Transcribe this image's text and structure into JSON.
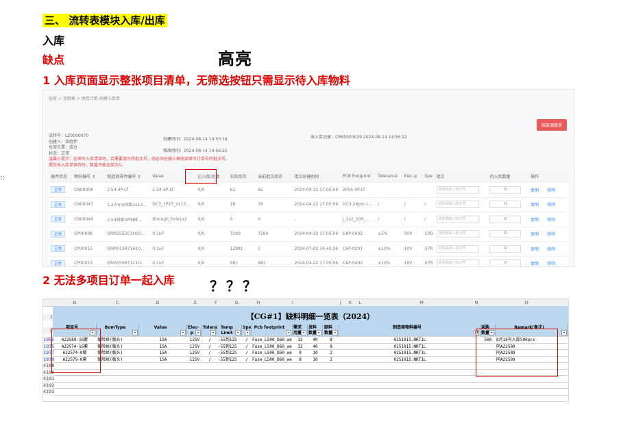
{
  "doc": {
    "heading": "三、 流转表模块入库/出库",
    "section": "入库",
    "weakness": "缺点",
    "highlight": "高亮",
    "issue1": "1 入库页面显示整张项目清单，无筛选按钮只需显示待入库物料",
    "issue2": "2 无法多项目订单一起入库",
    "question_marks": "？？？",
    "side_glyph": "::"
  },
  "shot1": {
    "breadcrumb": "仓库 > 流转表 > 项目订单-创建入库单",
    "confirm_button": "结束调拨单",
    "meta_left": [
      "流转号：LZ0000070",
      "创建人：张晓伊",
      "仓库位置：成仓",
      "状态：正常"
    ],
    "meta_note": [
      "温馨小提示：在填写入库清单时，若需要填写的批次号，则必须在输入框底部填写订单号的批次号。",
      "提交出入库单保存时，数量不能全部为0。"
    ],
    "meta_mid": [
      "创建时间：2024-08-14 14:50:18",
      "修改时间：2024-08-14 14:56:22"
    ],
    "meta_right": "出入库记录：CRK0000029 2024-08-14 14:56:22",
    "columns": [
      "器件状态",
      "物料编号 ⇕",
      "制造商零件编号 ⇕",
      "Value",
      "已入库/总数",
      "实际库存",
      "当前批次库存",
      "批次创建时间",
      "PCB Footprint",
      "Tolerance",
      "Elec-p",
      "Spe",
      "批次",
      "待入库数量",
      "操作"
    ],
    "rows": [
      {
        "status": "正常",
        "code": "CN00006",
        "mpn": "2.54-4P-LT",
        "value": "2.54-4P-LT",
        "ratio": "0/0",
        "stock": "61",
        "batch": "61",
        "time": "2024-04-22 17:05:06",
        "fp": "2P54-4P-LT",
        "tol": "",
        "elec": "",
        "spe": "",
        "sel": "选择或输入批次号",
        "qty": "0",
        "op1": "复制",
        "op2": "移除"
      },
      {
        "status": "正常",
        "code": "CN00047",
        "mpn": "1.27mm间距2x13...",
        "value": "DC3_1P27_2x13...",
        "ratio": "0/0",
        "stock": "18",
        "batch": "18",
        "time": "2024-04-22 17:05:06",
        "fp": "DC3-26pin-1...",
        "tol": "/",
        "elec": "/",
        "spe": "/",
        "sel": "选择或输入批次号",
        "qty": "0",
        "op1": "复制",
        "op2": "移除"
      },
      {
        "status": "正常",
        "code": "CN00049",
        "mpn": "2.54间距4PIN排...",
        "value": "through_hole1x2",
        "ratio": "0/0",
        "stock": "0",
        "batch": "0",
        "time": "-",
        "fp": "J_1x2_100_...",
        "tol": "/",
        "elec": "/",
        "spe": "/",
        "sel": "选择或输入批次号",
        "qty": "0",
        "op1": "复制",
        "op2": "移除"
      },
      {
        "status": "正常",
        "code": "CP00006",
        "mpn": "GRM1555C1H10...",
        "value": "0.1nF",
        "ratio": "0/0",
        "stock": "7260",
        "batch": "7260",
        "time": "2024-04-22 17:05:06",
        "fp": "CAP-0402",
        "tol": "±5%",
        "elec": "50V",
        "spe": "C0G",
        "sel": "选择或输入批次号",
        "qty": "0",
        "op1": "复制",
        "op2": "移除"
      },
      {
        "status": "正常",
        "code": "CP00015",
        "mpn": "GRM033R71A10...",
        "value": "0.1uF",
        "ratio": "0/0",
        "stock": "12981",
        "batch": "1",
        "time": "2024-07-02 16:40:36",
        "fp": "CAP-0201",
        "tol": "±10%",
        "elec": "10V",
        "spe": "X7R",
        "sel": "选择或输入批次号",
        "qty": "0",
        "op1": "复制",
        "op2": "移除"
      },
      {
        "status": "正常",
        "code": "CP00023",
        "mpn": "GRM155R71C10...",
        "value": "0.1uF",
        "ratio": "0/0",
        "stock": "981",
        "batch": "981",
        "time": "2024-04-22 17:05:06",
        "fp": "CAP-0402",
        "tol": "±10%",
        "elec": "16V",
        "spe": "X7R",
        "sel": "选择或输入批次号",
        "qty": "0",
        "op1": "复制",
        "op2": "移除"
      }
    ]
  },
  "shot2": {
    "col_letters": [
      "B",
      "C",
      "D",
      "E",
      "F",
      "G",
      "H",
      "I",
      "J",
      "K",
      "L",
      "M",
      "N",
      "O"
    ],
    "title": "【CG#1】缺料明细一览表（2024）",
    "headers": [
      "项目号",
      "BomType",
      "Value",
      "Elec-p",
      "Tolerance",
      "Temp Limit",
      "Spe",
      "Pcb footprint",
      "需求用量",
      "发料数量",
      "缺料数量",
      "制造商物料编号",
      "采购数量",
      "Remark(备注)"
    ],
    "row_numbers": [
      "1",
      "2",
      "1955",
      "1975",
      "1977",
      "1979",
      "4188",
      "4190",
      "4191",
      "4192",
      "4193"
    ],
    "rows": [
      {
        "proj": "A22589-16套",
        "bom": "保险丝(板头)",
        "val": "15A",
        "elec": "125V",
        "tol": "/",
        "temp": "-55到125",
        "spe": "/",
        "fp": "Fuse_L500_D60_weld",
        "need": "32",
        "issue": "40",
        "short": "8",
        "mpn": "0251015.NRT1L",
        "buy": "500",
        "remark": "8月16号入库500pcs"
      },
      {
        "proj": "A22574-16套",
        "bom": "保险丝(板头)",
        "val": "15A",
        "elec": "125V",
        "tol": "/",
        "temp": "-55到125",
        "spe": "/",
        "fp": "Fuse_L500_D60_weld",
        "need": "32",
        "issue": "40",
        "short": "8",
        "mpn": "0251015.NRT1L",
        "buy": "",
        "remark": "同A22589"
      },
      {
        "proj": "A22574-8套",
        "bom": "保险丝(板头)",
        "val": "15A",
        "elec": "125V",
        "tol": "/",
        "temp": "-55到125",
        "spe": "/",
        "fp": "Fuse_L500_D60_weld",
        "need": "8",
        "issue": "10",
        "short": "2",
        "mpn": "0251015.NRT1L",
        "buy": "",
        "remark": "同A22589"
      },
      {
        "proj": "A22579-8套",
        "bom": "保险丝(板头)",
        "val": "15A",
        "elec": "125V",
        "tol": "/",
        "temp": "-55到125",
        "spe": "/",
        "fp": "Fuse_L500_D60_weld",
        "need": "8",
        "issue": "10",
        "short": "2",
        "mpn": "0251015.NRT1L",
        "buy": "",
        "remark": "同A22589"
      }
    ],
    "filter_arrow": "▾",
    "filter_active": "↓T"
  }
}
